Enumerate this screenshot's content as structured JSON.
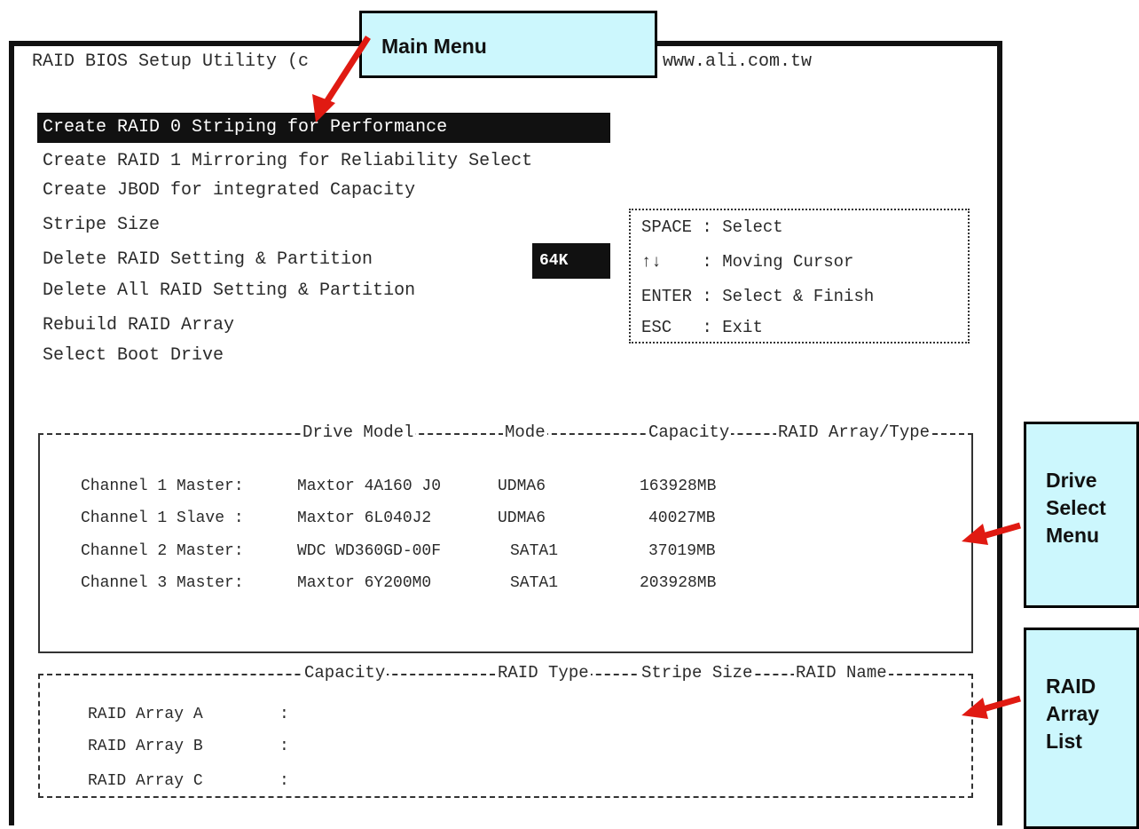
{
  "header": {
    "title_prefix": "RAID BIOS Setup Utility (c",
    "url": "www.ali.com.tw"
  },
  "main_menu": {
    "items": [
      {
        "label": "Create RAID 0 Striping for Performance",
        "selected": true
      },
      {
        "label": "Create RAID 1 Mirroring for Reliability Select",
        "selected": false
      },
      {
        "label": "Create JBOD for integrated Capacity",
        "selected": false
      },
      {
        "label": "Stripe Size",
        "selected": false
      },
      {
        "label": "Delete RAID Setting & Partition",
        "selected": false
      },
      {
        "label": "Delete All RAID Setting & Partition",
        "selected": false
      },
      {
        "label": "Rebuild RAID Array",
        "selected": false
      },
      {
        "label": "Select Boot Drive",
        "selected": false
      }
    ],
    "stripe_size_value": "64K"
  },
  "help": {
    "lines": [
      {
        "key": "SPACE",
        "sep": ":",
        "action": "Select"
      },
      {
        "key": "↑↓",
        "sep": ":",
        "action": "Moving Cursor"
      },
      {
        "key": "ENTER",
        "sep": ":",
        "action": "Select & Finish"
      },
      {
        "key": "ESC",
        "sep": ":",
        "action": "Exit"
      }
    ]
  },
  "drive_table": {
    "headers": {
      "model": "Drive Model",
      "mode": "Mode",
      "capacity": "Capacity",
      "raid": "RAID Array/Type"
    },
    "rows": [
      {
        "channel": "Channel 1 Master",
        "model": "Maxtor 4A160 J0",
        "mode": "UDMA6",
        "capacity": "163928MB"
      },
      {
        "channel": "Channel 1 Slave",
        "model": "Maxtor 6L040J2",
        "mode": "UDMA6",
        "capacity": "40027MB"
      },
      {
        "channel": "Channel 2 Master",
        "model": "WDC WD360GD-00F",
        "mode": "SATA1",
        "capacity": "37019MB"
      },
      {
        "channel": "Channel 3 Master",
        "model": "Maxtor 6Y200M0",
        "mode": "SATA1",
        "capacity": "203928MB"
      }
    ]
  },
  "array_table": {
    "headers": {
      "capacity": "Capacity",
      "type": "RAID Type",
      "stripe": "Stripe Size",
      "name": "RAID Name"
    },
    "rows": [
      {
        "label": "RAID Array A",
        "sep": ":"
      },
      {
        "label": "RAID Array B",
        "sep": ":"
      },
      {
        "label": "RAID Array C",
        "sep": ":"
      }
    ]
  },
  "callouts": {
    "main_menu": "Main Menu",
    "drive_select": [
      "Drive",
      "Select",
      "Menu"
    ],
    "raid_list": [
      "RAID",
      "Array",
      "List"
    ]
  },
  "colors": {
    "callout_fill": "#ccf7fd",
    "arrow": "#e01a12",
    "highlight": "#111111"
  }
}
